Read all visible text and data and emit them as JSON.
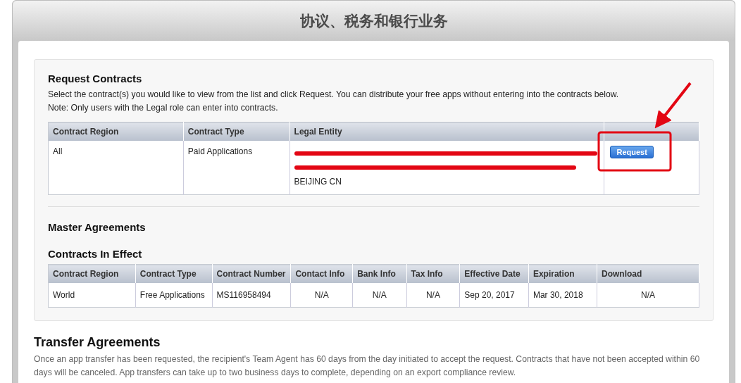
{
  "page": {
    "title": "协议、税务和银行业务"
  },
  "request_contracts": {
    "heading": "Request Contracts",
    "description": "Select the contract(s) you would like to view from the list and click Request. You can distribute your free apps without entering into the contracts below.",
    "note": "Note: Only users with the Legal role can enter into contracts.",
    "table": {
      "columns": [
        "Contract Region",
        "Contract Type",
        "Legal Entity"
      ],
      "rows": [
        {
          "contract_region": "All",
          "contract_type": "Paid Applications",
          "legal_entity_lines": [
            "BEIJING CN"
          ],
          "button": "Request"
        }
      ]
    }
  },
  "master_agreements": {
    "heading": "Master Agreements"
  },
  "contracts_in_effect": {
    "heading": "Contracts In Effect",
    "table": {
      "columns": [
        "Contract Region",
        "Contract Type",
        "Contract Number",
        "Contact Info",
        "Bank Info",
        "Tax Info",
        "Effective Date",
        "Expiration",
        "Download"
      ],
      "rows": [
        {
          "cells": [
            "World",
            "Free Applications",
            "MS116958494",
            "N/A",
            "N/A",
            "N/A",
            "Sep 20, 2017",
            "Mar 30, 2018",
            "N/A"
          ]
        }
      ]
    }
  },
  "transfer_agreements": {
    "heading": "Transfer Agreements",
    "description": "Once an app transfer has been requested, the recipient's Team Agent has 60 days from the day initiated to accept the request. Contracts that have not been accepted within 60 days will be canceled. App transfers can take up to two business days to complete, depending on an export compliance review."
  }
}
